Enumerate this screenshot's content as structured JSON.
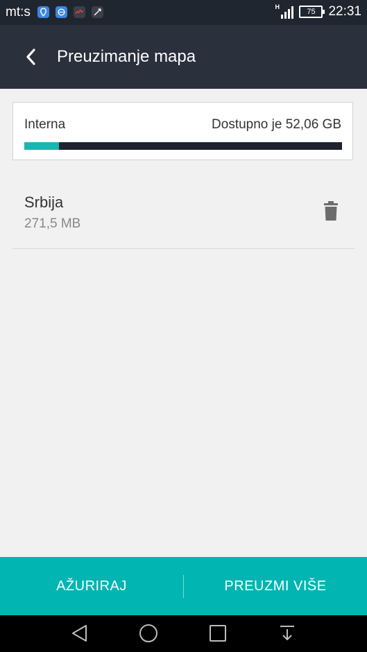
{
  "status_bar": {
    "carrier": "mt:s",
    "network": "H",
    "battery": "75",
    "time": "22:31"
  },
  "app_bar": {
    "title": "Preuzimanje mapa"
  },
  "storage": {
    "label": "Interna",
    "available": "Dostupno je 52,06 GB",
    "used_fraction": 0.11,
    "accent_color": "#1bb5b3"
  },
  "maps": [
    {
      "name": "Srbija",
      "size": "271,5 MB"
    }
  ],
  "bottom_bar": {
    "update_label": "AŽURIRAJ",
    "download_more_label": "PREUZMI VIŠE",
    "color": "#00b5b2"
  },
  "icons": {
    "back": "back-arrow-icon",
    "delete": "trash-icon",
    "nav": [
      "nav-back-icon",
      "nav-home-icon",
      "nav-recents-icon",
      "nav-notifications-icon"
    ]
  }
}
